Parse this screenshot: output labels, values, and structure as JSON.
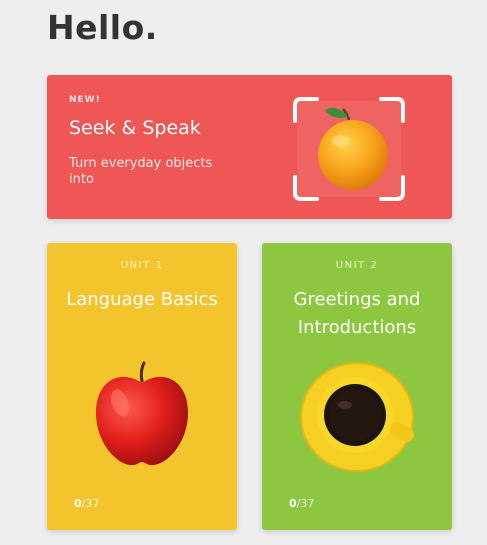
{
  "header": {
    "greeting": "Hello."
  },
  "feature": {
    "badge": "NEW!",
    "title": "Seek & Speak",
    "subtitle": "Turn everyday objects into",
    "image_icon": "orange-in-scan-frame",
    "color": "#ef5656"
  },
  "units": [
    {
      "label": "UNIT 1",
      "title": "Language Basics",
      "image_icon": "red-apple",
      "progress_done": "0",
      "progress_total": "/37",
      "color": "#f3c42b"
    },
    {
      "label": "UNIT 2",
      "title": "Greetings and Introductions",
      "image_icon": "coffee-cup",
      "progress_done": "0",
      "progress_total": "/37",
      "color": "#8dc63f"
    }
  ]
}
